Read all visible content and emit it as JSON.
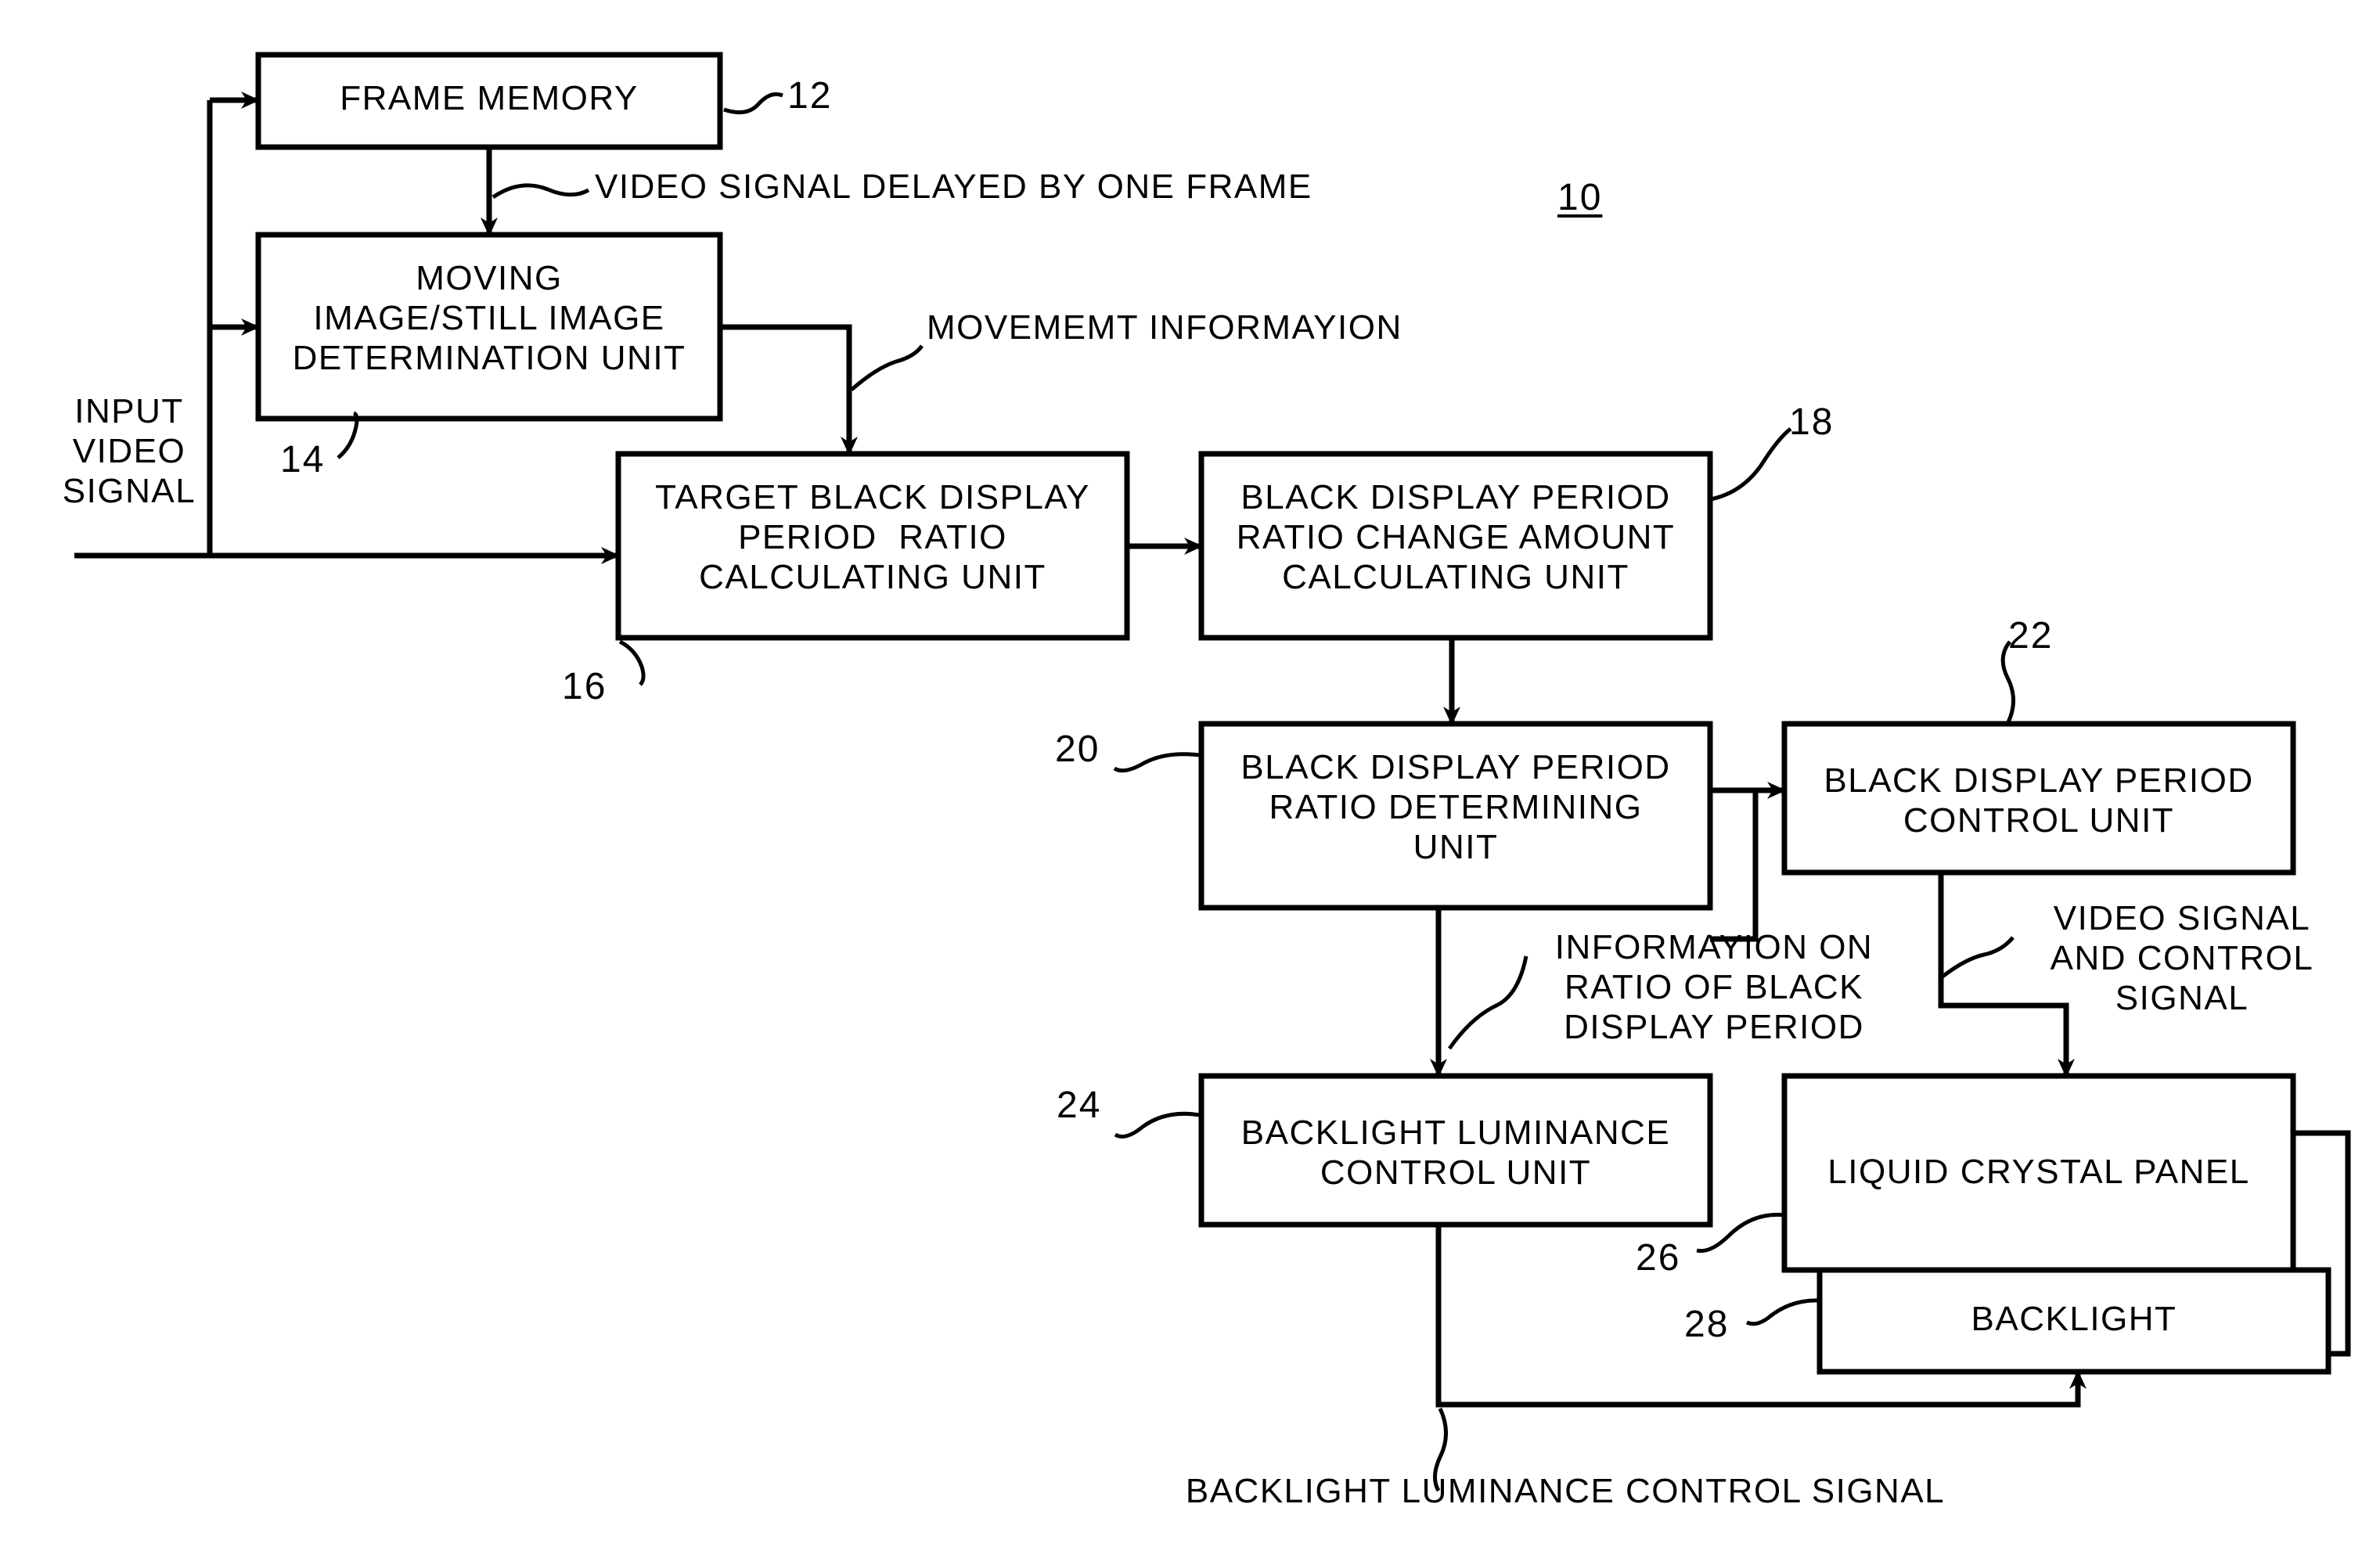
{
  "figure": {
    "system_ref": "10",
    "blocks": [
      {
        "id": "frame_memory",
        "ref": "12",
        "label": "FRAME MEMORY"
      },
      {
        "id": "determination",
        "ref": "14",
        "label": "MOVING\nIMAGE/STILL IMAGE\nDETERMINATION UNIT"
      },
      {
        "id": "target_ratio",
        "ref": "16",
        "label": "TARGET BLACK DISPLAY\nPERIOD  RATIO\nCALCULATING UNIT"
      },
      {
        "id": "change_amount",
        "ref": "18",
        "label": "BLACK DISPLAY PERIOD\nRATIO CHANGE AMOUNT\nCALCULATING UNIT"
      },
      {
        "id": "ratio_determining",
        "ref": "20",
        "label": "BLACK DISPLAY PERIOD\nRATIO DETERMINING\nUNIT"
      },
      {
        "id": "period_control",
        "ref": "22",
        "label": "BLACK DISPLAY PERIOD\nCONTROL UNIT"
      },
      {
        "id": "backlight_control",
        "ref": "24",
        "label": "BACKLIGHT LUMINANCE\nCONTROL UNIT"
      },
      {
        "id": "lcd_panel",
        "ref": "26",
        "label": "LIQUID CRYSTAL PANEL"
      },
      {
        "id": "backlight",
        "ref": "28",
        "label": "BACKLIGHT"
      }
    ],
    "signals": [
      {
        "id": "input_video",
        "label": "INPUT\nVIDEO\nSIGNAL"
      },
      {
        "id": "delayed_video",
        "label": "VIDEO SIGNAL DELAYED BY ONE FRAME"
      },
      {
        "id": "movement_info",
        "label": "MOVEMEMT INFORMAYION"
      },
      {
        "id": "ratio_info",
        "label": "INFORMAYION ON\nRATIO OF BLACK\nDISPLAY PERIOD"
      },
      {
        "id": "video_and_control",
        "label": "VIDEO SIGNAL\nAND CONTROL\nSIGNAL"
      },
      {
        "id": "backlight_luminance_control_signal",
        "label": "BACKLIGHT LUMINANCE CONTROL SIGNAL"
      }
    ],
    "colors": {
      "ink": "#000000",
      "paper": "#ffffff"
    }
  }
}
